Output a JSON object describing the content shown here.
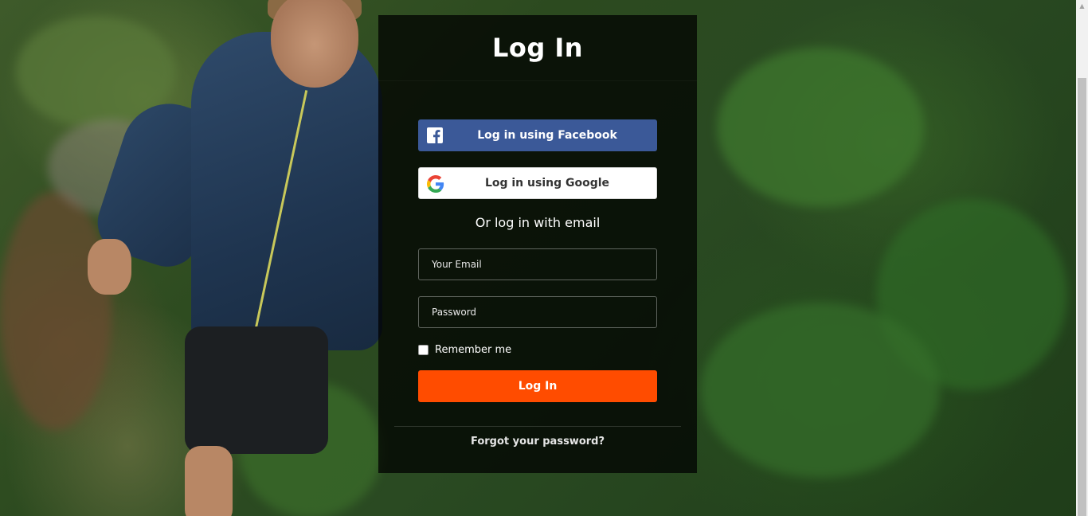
{
  "panel": {
    "title": "Log In"
  },
  "social": {
    "facebook_label": "Log in using Facebook",
    "google_label": "Log in using Google"
  },
  "divider_text": "Or log in with email",
  "form": {
    "email_placeholder": "Your Email",
    "email_value": "",
    "password_placeholder": "Password",
    "password_value": "",
    "remember_label": "Remember me",
    "remember_checked": false,
    "submit_label": "Log In"
  },
  "footer": {
    "forgot_label": "Forgot your password?"
  },
  "colors": {
    "facebook": "#3b5998",
    "primary_button": "#ff4c00",
    "panel_overlay": "rgba(0,0,0,0.74)"
  },
  "icons": {
    "facebook": "facebook-icon",
    "google": "google-icon"
  }
}
